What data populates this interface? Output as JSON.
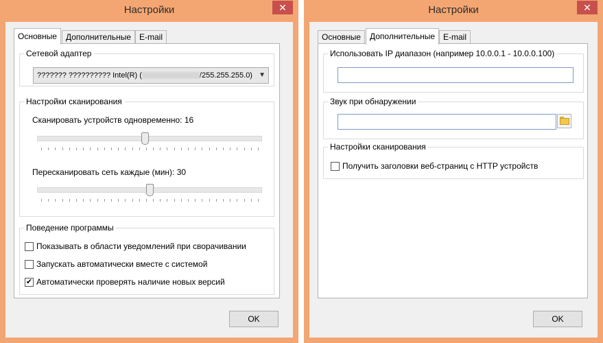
{
  "left_window": {
    "title": "Настройки",
    "close_glyph": "✕",
    "tabs": [
      "Основные",
      "Дополнительные",
      "E-mail"
    ],
    "network": {
      "group_title": "Сетевой адаптер",
      "adapter_prefix": "??????? ?????????? Intel(R) (",
      "adapter_suffix": "/255.255.255.0)"
    },
    "scan": {
      "group_title": "Настройки сканирования",
      "devices_label": "Сканировать устройств одновременно: 16",
      "devices_slider_fraction": 0.48,
      "rescan_label": "Пересканировать сеть каждые (мин): 30",
      "rescan_slider_fraction": 0.5
    },
    "behavior": {
      "group_title": "Поведение программы",
      "options": [
        {
          "label": "Показывать в области уведомлений при сворачивании",
          "checked": false
        },
        {
          "label": "Запускать автоматически вместе с системой",
          "checked": false
        },
        {
          "label": "Автоматически проверять наличие новых версий",
          "checked": true
        }
      ]
    },
    "ok_label": "OK"
  },
  "right_window": {
    "title": "Настройки",
    "close_glyph": "✕",
    "tabs": [
      "Основные",
      "Дополнительные",
      "E-mail"
    ],
    "ip_range": {
      "group_title": "Использовать IP диапазон (например 10.0.0.1 - 10.0.0.100)",
      "value": ""
    },
    "sound": {
      "group_title": "Звук при обнаружении",
      "value": ""
    },
    "scan": {
      "group_title": "Настройки сканирования",
      "option": {
        "label": "Получить заголовки веб-страниц с HTTP устройств",
        "checked": false
      }
    },
    "ok_label": "OK"
  },
  "icons": {
    "close": "close-icon",
    "browse": "folder-icon",
    "dropdown": "chevron-down-icon",
    "check": "checkmark-icon"
  },
  "colors": {
    "frame": "#f4a672",
    "close_button": "#c7504d",
    "input_border": "#7a9cc9"
  }
}
